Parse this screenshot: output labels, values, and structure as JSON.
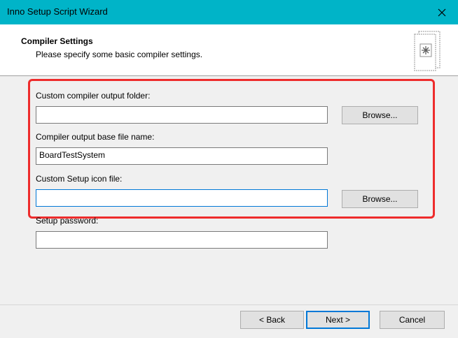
{
  "window": {
    "title": "Inno Setup Script Wizard",
    "close_symbol": "✕"
  },
  "header": {
    "title": "Compiler Settings",
    "subtitle": "Please specify some basic compiler settings.",
    "icon": "wizard-setup-icon"
  },
  "fields": {
    "output_folder": {
      "label": "Custom compiler output folder:",
      "value": ""
    },
    "base_file_name": {
      "label": "Compiler output base file name:",
      "value": "BoardTestSystem"
    },
    "icon_file": {
      "label": "Custom Setup icon file:",
      "value": ""
    },
    "password": {
      "label": "Setup password:",
      "value": ""
    }
  },
  "buttons": {
    "browse_output": "Browse...",
    "browse_icon": "Browse...",
    "back": "< Back",
    "next": "Next >",
    "cancel": "Cancel"
  },
  "colors": {
    "titlebar": "#00b4c8",
    "highlight_border": "#ee2c2c",
    "focus_border": "#0078d7"
  }
}
